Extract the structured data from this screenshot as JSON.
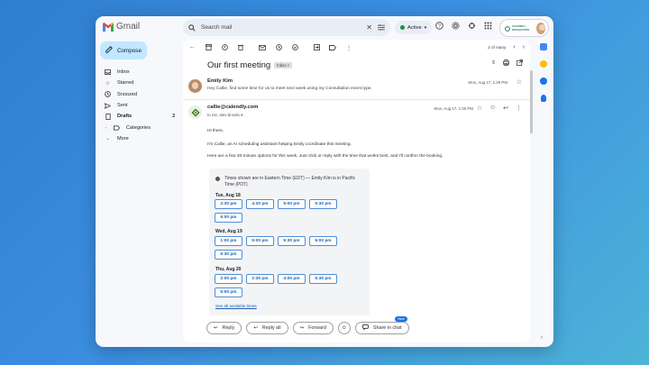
{
  "app": {
    "name": "Gmail"
  },
  "search": {
    "placeholder": "Search mail"
  },
  "status": {
    "label": "Active"
  },
  "brand": {
    "label": "CALENDLY INTEGRATION"
  },
  "sidebar": {
    "compose_label": "Compose",
    "items": [
      {
        "label": "Inbox",
        "icon": "inbox-icon"
      },
      {
        "label": "Starred",
        "icon": "star-icon"
      },
      {
        "label": "Snoozed",
        "icon": "clock-icon"
      },
      {
        "label": "Sent",
        "icon": "send-icon"
      },
      {
        "label": "Drafts",
        "icon": "draft-icon",
        "count": "2"
      },
      {
        "label": "Categories",
        "icon": "label-icon"
      },
      {
        "label": "More",
        "icon": "chevron-down-icon"
      }
    ]
  },
  "thread": {
    "pager": "2 of many",
    "subject": "Our first meeting",
    "label": "Inbox ×",
    "messages": [
      {
        "sender": "Emily Kim",
        "snippet": "Hey Callie, find some time for us to meet next week using my Consultation event type.",
        "date": "Mon, Aug 17, 1:29 PM"
      },
      {
        "sender": "callie@calendly.com",
        "to": "to me, alex.brooks ▾",
        "date": "Mon, Aug 17, 1:30 PM",
        "greeting": "Hi there,",
        "intro": "I'm Callie, an AI scheduling assistant helping Emily coordinate this meeting.",
        "options": "Here are a few 30-minute options for this week. Just click or reply with the time that works best, and I'll confirm the booking."
      }
    ]
  },
  "times": {
    "note": "Times shown are in Eastern Time (EDT) — Emily Kim is in Pacific Time (PDT)",
    "days": [
      {
        "label": "Tue, Aug 18",
        "slots": [
          "2:30 pm",
          "4:30 pm",
          "5:00 pm",
          "5:30 pm",
          "6:00 pm"
        ]
      },
      {
        "label": "Wed, Aug 19",
        "slots": [
          "1:00 pm",
          "5:00 pm",
          "5:30 pm",
          "6:00 pm",
          "6:30 pm"
        ]
      },
      {
        "label": "Thu, Aug 20",
        "slots": [
          "2:00 pm",
          "2:30 pm",
          "4:00 pm",
          "5:30 pm",
          "6:00 pm"
        ]
      }
    ],
    "see_all": "See all available times"
  },
  "actions": {
    "reply": "Reply",
    "reply_all": "Reply all",
    "forward": "Forward",
    "share": "Share in chat",
    "new_badge": "New"
  },
  "colors": {
    "accent": "#1a73e8",
    "compose_bg": "#c2e7ff",
    "slot_border": "#4f8ed8"
  }
}
